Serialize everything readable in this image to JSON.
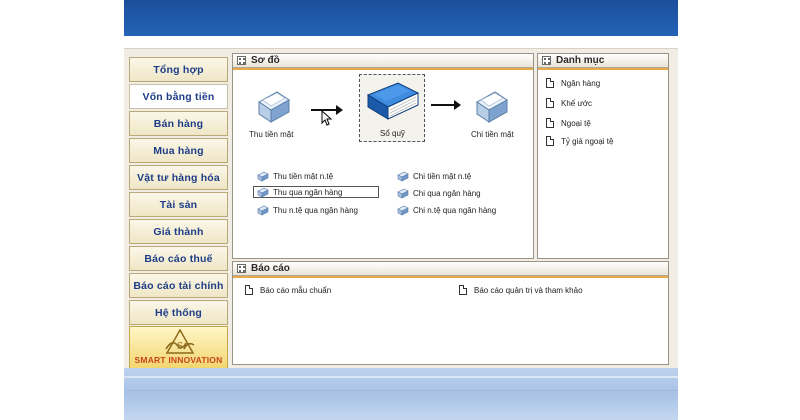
{
  "sidebar": {
    "items": [
      {
        "label": "Tổng hợp"
      },
      {
        "label": "Vốn bằng tiền"
      },
      {
        "label": "Bán hàng"
      },
      {
        "label": "Mua hàng"
      },
      {
        "label": "Vật tư hàng hóa"
      },
      {
        "label": "Tài sản"
      },
      {
        "label": "Giá thành"
      },
      {
        "label": "Báo cáo thuế"
      },
      {
        "label": "Báo cáo tài chính"
      },
      {
        "label": "Hệ thống"
      }
    ],
    "active_index": 1,
    "logo_text": "SMART INNOVATION"
  },
  "so_do": {
    "title": "Sơ đồ",
    "nodes": {
      "thu": "Thu tiền mặt",
      "so_quy": "Sổ quỹ",
      "chi": "Chi tiền mặt"
    },
    "tasks_left": [
      "Thu tiền mặt n.tệ",
      "Thu qua ngân hàng",
      "Thu n.tệ qua ngân hàng"
    ],
    "tasks_right": [
      "Chi tiền mặt n.tệ",
      "Chi qua ngân hàng",
      "Chi n.tệ qua ngân hàng"
    ]
  },
  "danh_muc": {
    "title": "Danh mục",
    "items": [
      "Ngân hàng",
      "Khế ước",
      "Ngoại tệ",
      "Tỷ giá ngoại tệ"
    ]
  },
  "bao_cao": {
    "title": "Báo cáo",
    "items": [
      "Báo cáo mẫu chuẩn",
      "Báo cáo quản trị và tham khảo"
    ]
  },
  "colors": {
    "banner_top": "#1b4f9a",
    "sidebar_text": "#1d3d86",
    "header_underline": "#e7a94a",
    "book_blue": "#1f6fc4"
  }
}
